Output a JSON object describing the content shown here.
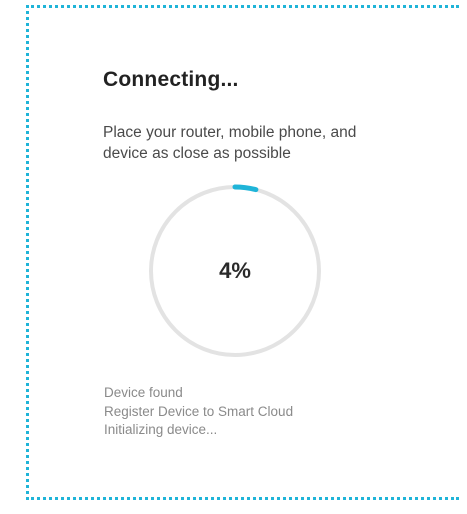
{
  "dialog": {
    "title": "Connecting...",
    "instruction": "Place your router, mobile phone, and device as close as possible"
  },
  "progress": {
    "value_label": "4%",
    "fraction": 0.04,
    "accent_color": "#1fb4d8",
    "track_color": "#e3e3e3"
  },
  "status": {
    "lines": [
      "Device found",
      "Register Device to Smart Cloud",
      "Initializing device..."
    ]
  },
  "colors": {
    "frame_border": "#1fb4d8"
  }
}
